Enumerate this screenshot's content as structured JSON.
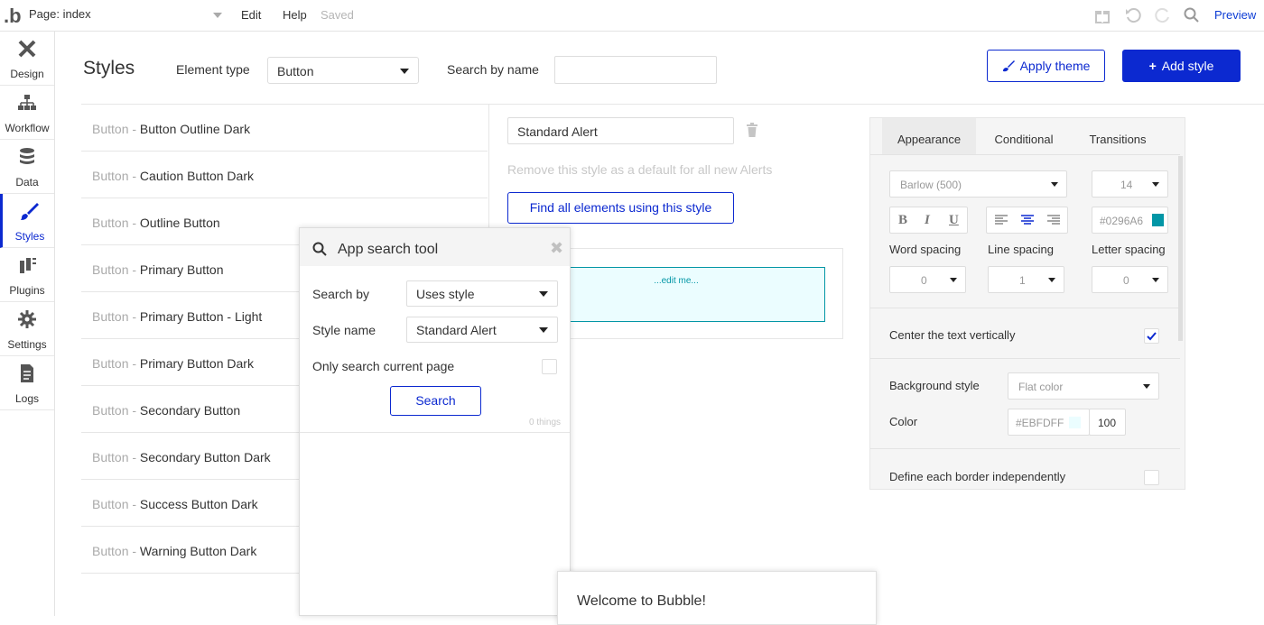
{
  "topbar": {
    "logo": ".b",
    "page_selector": "Page: index",
    "menu": [
      "Edit",
      "Help"
    ],
    "saved_status": "Saved",
    "preview_label": "Preview"
  },
  "nav": [
    {
      "label": "Design",
      "icon": "design-icon"
    },
    {
      "label": "Workflow",
      "icon": "workflow-icon"
    },
    {
      "label": "Data",
      "icon": "database-icon"
    },
    {
      "label": "Styles",
      "icon": "brush-icon",
      "active": true
    },
    {
      "label": "Plugins",
      "icon": "plug-icon"
    },
    {
      "label": "Settings",
      "icon": "gear-icon"
    },
    {
      "label": "Logs",
      "icon": "document-icon"
    }
  ],
  "header": {
    "title": "Styles",
    "element_type_label": "Element type",
    "element_type_value": "Button",
    "search_by_name_label": "Search by name",
    "search_by_name_value": "",
    "apply_theme_label": "Apply theme",
    "add_style_label": "Add style"
  },
  "style_list": [
    {
      "prefix": "Button - ",
      "name": "Button Outline Dark"
    },
    {
      "prefix": "Button - ",
      "name": "Caution Button Dark"
    },
    {
      "prefix": "Button - ",
      "name": "Outline Button"
    },
    {
      "prefix": "Button - ",
      "name": "Primary Button"
    },
    {
      "prefix": "Button - ",
      "name": "Primary Button - Light"
    },
    {
      "prefix": "Button - ",
      "name": "Primary Button Dark"
    },
    {
      "prefix": "Button - ",
      "name": "Secondary Button"
    },
    {
      "prefix": "Button - ",
      "name": "Secondary Button Dark"
    },
    {
      "prefix": "Button - ",
      "name": "Success Button Dark"
    },
    {
      "prefix": "Button - ",
      "name": "Warning Button Dark"
    }
  ],
  "editor": {
    "style_name": "Standard Alert",
    "remove_default_text": "Remove this style as a default for all new Alerts",
    "find_all_label": "Find all elements using this style",
    "preview_text": "...edit me..."
  },
  "properties": {
    "tabs": [
      "Appearance",
      "Conditional",
      "Transitions"
    ],
    "active_tab": "Appearance",
    "font": "Barlow (500)",
    "font_size": "14",
    "bold": "B",
    "italic": "I",
    "underline": "U",
    "text_color": "#0296A6",
    "word_spacing_label": "Word spacing",
    "line_spacing_label": "Line spacing",
    "letter_spacing_label": "Letter spacing",
    "word_spacing": "0",
    "line_spacing": "1",
    "letter_spacing": "0",
    "center_vertically_label": "Center the text vertically",
    "center_vertically_checked": true,
    "background_style_label": "Background style",
    "background_style": "Flat color",
    "color_label": "Color",
    "bg_color": "#EBFDFF",
    "bg_opacity": "100",
    "border_independent_label": "Define each border independently"
  },
  "search_tool": {
    "title": "App search tool",
    "search_by_label": "Search by",
    "search_by_value": "Uses style",
    "style_name_label": "Style name",
    "style_name_value": "Standard Alert",
    "current_page_label": "Only search current page",
    "search_button": "Search",
    "result_count": "0 things"
  },
  "welcome": {
    "text": "Welcome to Bubble!"
  },
  "colors": {
    "accent": "#0C29D0",
    "alert_text": "#0296A6",
    "alert_bg": "#EBFDFF"
  }
}
